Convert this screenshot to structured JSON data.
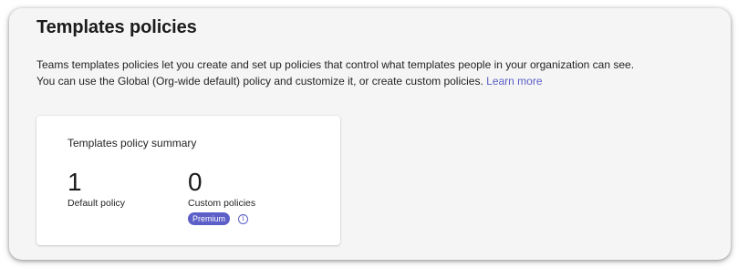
{
  "page": {
    "title": "Templates policies",
    "description_line1": "Teams templates policies let you create and set up policies that control what templates people in your organization can see.",
    "description_line2": "You can use the Global (Org-wide default) policy and customize it, or create custom policies.",
    "learn_more_label": "Learn more"
  },
  "summary_card": {
    "title": "Templates policy summary",
    "default_policy": {
      "value": "1",
      "label": "Default policy"
    },
    "custom_policies": {
      "value": "0",
      "label": "Custom policies",
      "badge": "Premium",
      "info_icon": "info-icon"
    }
  },
  "colors": {
    "accent": "#5b5fc7",
    "panel_background": "#f5f5f5",
    "card_background": "#ffffff"
  }
}
